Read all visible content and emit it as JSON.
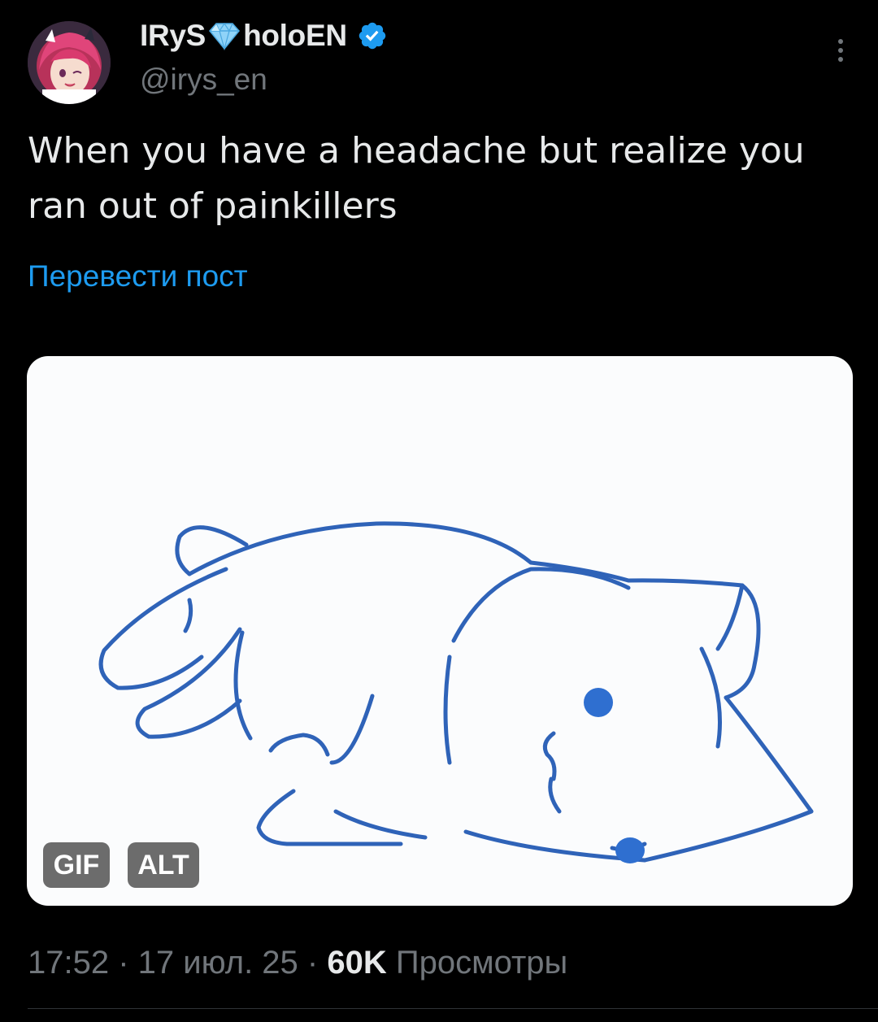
{
  "author": {
    "name_part1": "IRyS",
    "name_part2": "holoEN",
    "handle": "@irys_en",
    "name_emoji": "gem-icon",
    "verified_icon": "verified-badge-icon",
    "avatar": "avatar-image"
  },
  "tweet": {
    "text": "When you have a headache but realize you ran out of painkillers",
    "translate_label": "Перевести пост"
  },
  "media": {
    "type": "gif",
    "gif_badge": "GIF",
    "alt_badge": "ALT",
    "background_color": "#fbfcfd",
    "stroke_color": "#2f63b8"
  },
  "meta": {
    "time": "17:52",
    "sep1": " · ",
    "date": "17 июл. 25",
    "sep2": " · ",
    "views_count": "60K",
    "views_label": " Просмотры"
  },
  "colors": {
    "background": "#000000",
    "text_primary": "#e7e9ea",
    "text_secondary": "#71767b",
    "link": "#1d9bf0",
    "verified": "#1d9bf0"
  }
}
